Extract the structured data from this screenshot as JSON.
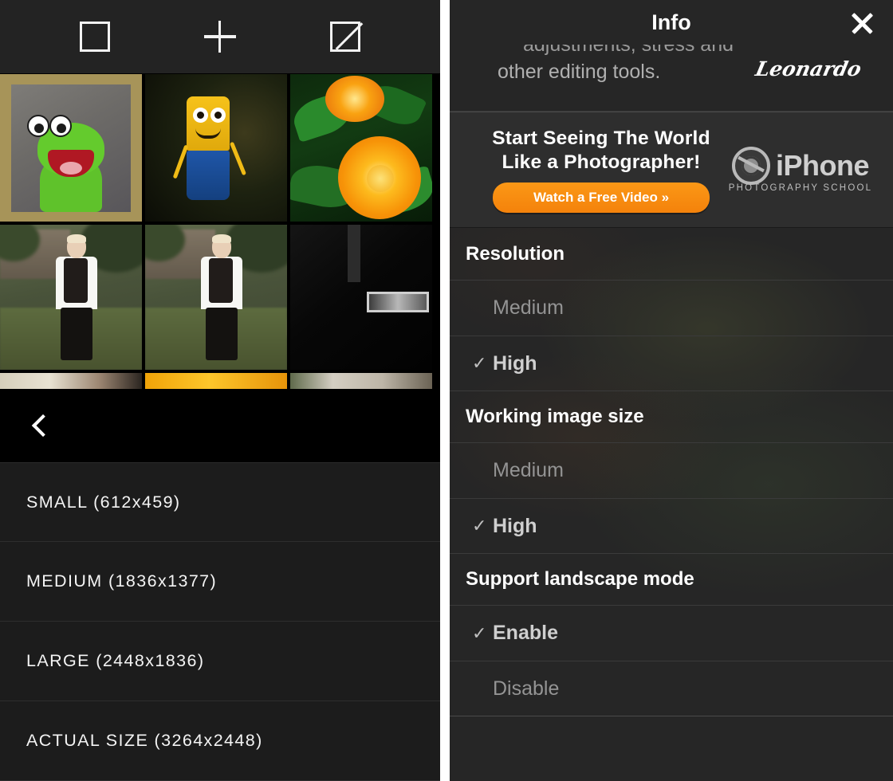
{
  "left_panel": {
    "toolbar": {
      "buttons": [
        {
          "name": "square-frame-button",
          "icon": "square-icon"
        },
        {
          "name": "add-button",
          "icon": "plus-icon"
        },
        {
          "name": "crop-diagonal-button",
          "icon": "square-diagonal-icon"
        }
      ]
    },
    "gallery": {
      "thumbnails": [
        {
          "name": "thumb-kermit-frog",
          "description": "green frog puppet on gray stone, khaki border"
        },
        {
          "name": "thumb-yellow-robot",
          "description": "yellow and blue tin robot figure in woods"
        },
        {
          "name": "thumb-orange-flowers",
          "description": "orange gerbera daisies with green leaves"
        },
        {
          "name": "thumb-portrait-left",
          "description": "person in white shirt and black vest on grass"
        },
        {
          "name": "thumb-portrait-right",
          "description": "person in white shirt and black vest near building"
        },
        {
          "name": "thumb-dark-mailslot",
          "description": "dark image with metal mail slot"
        },
        {
          "name": "thumb-strip-pale",
          "description": "partially visible pale image row"
        },
        {
          "name": "thumb-strip-orange",
          "description": "partially visible orange image row"
        },
        {
          "name": "thumb-strip-neutral",
          "description": "partially visible neutral image row"
        }
      ]
    },
    "back_button": {
      "icon": "chevron-left-icon"
    },
    "size_list": {
      "items": [
        {
          "label": "SMALL (612x459)"
        },
        {
          "label": "MEDIUM (1836x1377)"
        },
        {
          "label": "LARGE (2448x1836)"
        },
        {
          "label": "ACTUAL SIZE (3264x2448)"
        }
      ]
    }
  },
  "right_panel": {
    "header": {
      "title": "Info",
      "close_icon": "close-icon"
    },
    "promo_text": {
      "cut_line": "adjustments, stress and",
      "line": "other editing tools.",
      "signature": "Leonardo"
    },
    "ad": {
      "headline_line1": "Start Seeing The World",
      "headline_line2": "Like a Photographer!",
      "cta_label": "Watch a Free Video »",
      "cta_color": "#f7900d",
      "logo_word": "iPhone",
      "logo_sub": "PHOTOGRAPHY SCHOOL",
      "logo_icon": "aperture-icon"
    },
    "sections": [
      {
        "title": "Resolution",
        "options": [
          {
            "label": "Medium",
            "selected": false
          },
          {
            "label": "High",
            "selected": true
          }
        ]
      },
      {
        "title": "Working image size",
        "options": [
          {
            "label": "Medium",
            "selected": false
          },
          {
            "label": "High",
            "selected": true
          }
        ]
      },
      {
        "title": "Support landscape mode",
        "options": [
          {
            "label": "Enable",
            "selected": true
          },
          {
            "label": "Disable",
            "selected": false
          }
        ]
      }
    ],
    "check_glyph": "✓"
  }
}
